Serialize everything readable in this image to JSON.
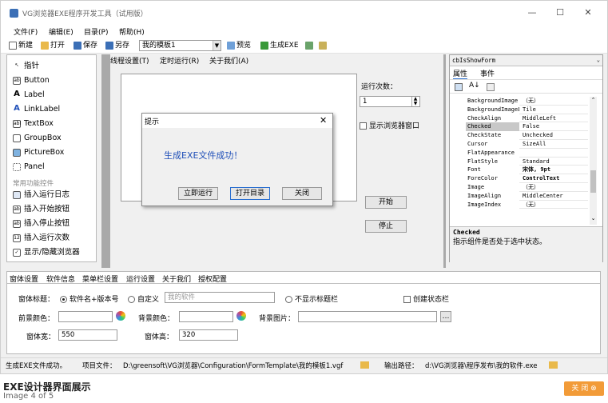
{
  "window": {
    "title": "VG浏览器EXE程序开发工具（试用版）",
    "min": "—",
    "max": "☐",
    "close": "✕"
  },
  "menu": [
    "文件(F)",
    "编辑(E)",
    "目录(P)",
    "帮助(H)"
  ],
  "toolbar": {
    "new": "新建",
    "open": "打开",
    "save": "保存",
    "saveas": "另存",
    "template": "我的模板1",
    "preview": "预览",
    "generate": "生成EXE"
  },
  "toolbox": {
    "items": [
      "指针",
      "Button",
      "Label",
      "LinkLabel",
      "TextBox",
      "GroupBox",
      "PictureBox",
      "Panel"
    ],
    "section": "常用功能控件",
    "func_items": [
      "插入运行日志",
      "插入开始按钮",
      "插入停止按钮",
      "插入运行次数",
      "显示/隐藏浏览器"
    ]
  },
  "form": {
    "menu": [
      "线程设置(T)",
      "定时运行(R)",
      "关于我们(A)"
    ],
    "run_count_label": "运行次数：",
    "run_count_value": "1",
    "show_browser": "显示浏览器窗口",
    "start": "开始",
    "stop": "停止"
  },
  "dialog": {
    "title": "提示",
    "close": "✕",
    "message": "生成EXE文件成功！",
    "run": "立即运行",
    "open_dir": "打开目录",
    "close_btn": "关闭"
  },
  "props": {
    "object": "cbIsShowForm",
    "tab_props": "属性",
    "tab_events": "事件",
    "rows": [
      {
        "n": "BackgroundImage",
        "v": "（无）"
      },
      {
        "n": "BackgroundImageLayout",
        "v": "Tile"
      },
      {
        "n": "CheckAlign",
        "v": "MiddleLeft"
      },
      {
        "n": "Checked",
        "v": "False"
      },
      {
        "n": "CheckState",
        "v": "Unchecked"
      },
      {
        "n": "Cursor",
        "v": "SizeAll"
      },
      {
        "n": "FlatAppearance",
        "v": ""
      },
      {
        "n": "FlatStyle",
        "v": "Standard"
      },
      {
        "n": "Font",
        "v": "宋体, 9pt"
      },
      {
        "n": "ForeColor",
        "v": "ControlText"
      },
      {
        "n": "Image",
        "v": "（无）"
      },
      {
        "n": "ImageAlign",
        "v": "MiddleCenter"
      },
      {
        "n": "ImageIndex",
        "v": "（无）"
      }
    ],
    "desc_title": "Checked",
    "desc_text": "指示组件是否处于选中状态。"
  },
  "bottom": {
    "tabs": [
      "窗体设置",
      "软件信息",
      "菜单栏设置",
      "运行设置",
      "关于我们",
      "授权配置"
    ],
    "title_label": "窗体标题：",
    "opt1": "软件名+版本号",
    "opt2": "自定义",
    "custom_placeholder": "我的软件",
    "no_titlebar": "不显示标题栏",
    "create_status": "创建状态栏",
    "fg_label": "前景颜色：",
    "bg_label": "背景颜色：",
    "bgimg_label": "背景图片：",
    "width_label": "窗体宽：",
    "width_value": "550",
    "height_label": "窗体高：",
    "height_value": "320"
  },
  "status": {
    "msg": "生成EXE文件成功。",
    "file_label": "项目文件：",
    "file": "D:\\greensoft\\VG浏览器\\Configuration\\FormTemplate\\我的模板1.vgf",
    "out_label": "输出路径：",
    "out": "d:\\VG浏览器\\程序发布\\我的软件.exe"
  },
  "caption": {
    "title": "EXE设计器界面展示",
    "sub": "Image 4 of 5",
    "close": "关 闭"
  }
}
